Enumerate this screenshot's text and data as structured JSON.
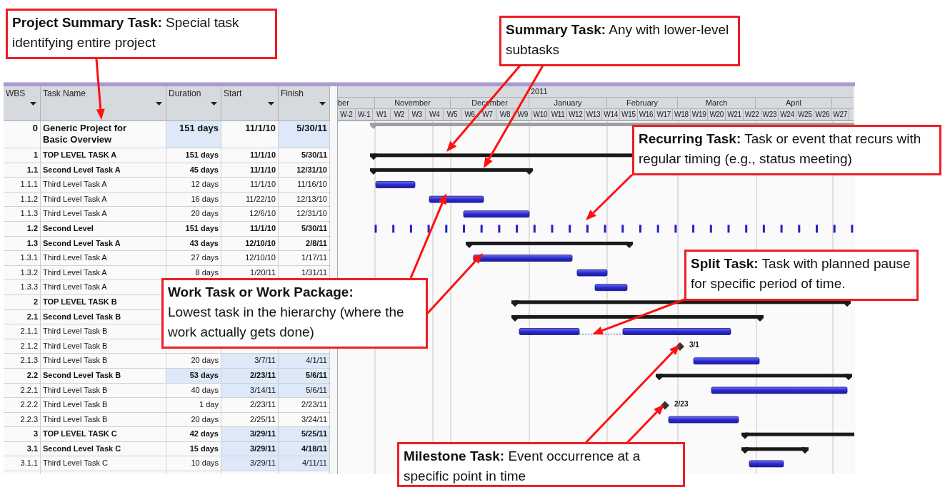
{
  "columns": [
    {
      "label": "WBS"
    },
    {
      "label": "Task Name"
    },
    {
      "label": "Duration"
    },
    {
      "label": "Start"
    },
    {
      "label": "Finish"
    }
  ],
  "timescale": {
    "year": "2011",
    "months": [
      "ber",
      "November",
      "December",
      "January",
      "February",
      "March",
      "April"
    ],
    "weeks": [
      "W-2",
      "W-1",
      "W1",
      "W2",
      "W3",
      "W4",
      "W5",
      "W6",
      "W7",
      "W8",
      "W9",
      "W10",
      "W11",
      "W12",
      "W13",
      "W14",
      "W15",
      "W16",
      "W17",
      "W18",
      "W19",
      "W20",
      "W21",
      "W22",
      "W23",
      "W24",
      "W25",
      "W26",
      "W27"
    ]
  },
  "rows": [
    {
      "wbs": "0",
      "name": "Generic Project for Basic Overview",
      "kind": "project",
      "cells": [
        {
          "text": "151 days",
          "highlighted": true
        },
        {
          "text": "11/1/10",
          "highlighted": false
        },
        {
          "text": "5/30/11",
          "highlighted": true
        }
      ]
    },
    {
      "wbs": "1",
      "name": "TOP LEVEL TASK A",
      "kind": "summary",
      "cells": [
        {
          "text": "151 days",
          "highlighted": false
        },
        {
          "text": "11/1/10",
          "highlighted": false
        },
        {
          "text": "5/30/11",
          "highlighted": false
        }
      ]
    },
    {
      "wbs": "1.1",
      "name": "Second Level Task A",
      "kind": "summary",
      "cells": [
        {
          "text": "45 days",
          "highlighted": false
        },
        {
          "text": "11/1/10",
          "highlighted": false
        },
        {
          "text": "12/31/10",
          "highlighted": false
        }
      ]
    },
    {
      "wbs": "1.1.1",
      "name": "Third Level Task A",
      "kind": "task",
      "cells": [
        {
          "text": "12 days",
          "highlighted": false
        },
        {
          "text": "11/1/10",
          "highlighted": false
        },
        {
          "text": "11/16/10",
          "highlighted": false
        }
      ]
    },
    {
      "wbs": "1.1.2",
      "name": "Third Level Task A",
      "kind": "task",
      "cells": [
        {
          "text": "16 days",
          "highlighted": false
        },
        {
          "text": "11/22/10",
          "highlighted": false
        },
        {
          "text": "12/13/10",
          "highlighted": false
        }
      ]
    },
    {
      "wbs": "1.1.3",
      "name": "Third Level Task A",
      "kind": "task",
      "cells": [
        {
          "text": "20 days",
          "highlighted": false
        },
        {
          "text": "12/6/10",
          "highlighted": false
        },
        {
          "text": "12/31/10",
          "highlighted": false
        }
      ]
    },
    {
      "wbs": "1.2",
      "name": "Second Level",
      "kind": "recurring",
      "cells": [
        {
          "text": "151 days",
          "highlighted": false
        },
        {
          "text": "11/1/10",
          "highlighted": false
        },
        {
          "text": "5/30/11",
          "highlighted": false
        }
      ]
    },
    {
      "wbs": "1.3",
      "name": "Second Level Task A",
      "kind": "summary",
      "cells": [
        {
          "text": "43 days",
          "highlighted": false
        },
        {
          "text": "12/10/10",
          "highlighted": false
        },
        {
          "text": "2/8/11",
          "highlighted": false
        }
      ]
    },
    {
      "wbs": "1.3.1",
      "name": "Third Level Task A",
      "kind": "task",
      "cells": [
        {
          "text": "27 days",
          "highlighted": false
        },
        {
          "text": "12/10/10",
          "highlighted": false
        },
        {
          "text": "1/17/11",
          "highlighted": false
        }
      ]
    },
    {
      "wbs": "1.3.2",
      "name": "Third Level Task A",
      "kind": "task",
      "cells": [
        {
          "text": "8 days",
          "highlighted": false
        },
        {
          "text": "1/20/11",
          "highlighted": false
        },
        {
          "text": "1/31/11",
          "highlighted": false
        }
      ]
    },
    {
      "wbs": "1.3.3",
      "name": "Third Level Task A",
      "kind": "task"
    },
    {
      "wbs": "2",
      "name": "TOP LEVEL TASK B",
      "kind": "summary"
    },
    {
      "wbs": "2.1",
      "name": "Second Level Task B",
      "kind": "summary"
    },
    {
      "wbs": "2.1.1",
      "name": "Third Level Task B",
      "kind": "split"
    },
    {
      "wbs": "2.1.2",
      "name": "Third Level Task B",
      "kind": "milestone",
      "milestone_label": "3/1"
    },
    {
      "wbs": "2.1.3",
      "name": "Third Level Task B",
      "kind": "task",
      "cells": [
        {
          "text": "20 days",
          "highlighted": false
        },
        {
          "text": "3/7/11",
          "highlighted": true
        },
        {
          "text": "4/1/11",
          "highlighted": true
        }
      ]
    },
    {
      "wbs": "2.2",
      "name": "Second Level Task B",
      "kind": "summary",
      "cells": [
        {
          "text": "53 days",
          "highlighted": true
        },
        {
          "text": "2/23/11",
          "highlighted": true
        },
        {
          "text": "5/6/11",
          "highlighted": true
        }
      ]
    },
    {
      "wbs": "2.2.1",
      "name": "Third Level Task B",
      "kind": "task",
      "cells": [
        {
          "text": "40 days",
          "highlighted": false
        },
        {
          "text": "3/14/11",
          "highlighted": true
        },
        {
          "text": "5/6/11",
          "highlighted": true
        }
      ]
    },
    {
      "wbs": "2.2.2",
      "name": "Third Level Task B",
      "kind": "milestone",
      "milestone_label": "2/23",
      "cells": [
        {
          "text": "1 day",
          "highlighted": false
        },
        {
          "text": "2/23/11",
          "highlighted": false
        },
        {
          "text": "2/23/11",
          "highlighted": false
        }
      ]
    },
    {
      "wbs": "2.2.3",
      "name": "Third Level Task B",
      "kind": "task",
      "cells": [
        {
          "text": "20 days",
          "highlighted": false
        },
        {
          "text": "2/25/11",
          "highlighted": false
        },
        {
          "text": "3/24/11",
          "highlighted": false
        }
      ]
    },
    {
      "wbs": "3",
      "name": "TOP LEVEL TASK C",
      "kind": "summary",
      "cells": [
        {
          "text": "42 days",
          "highlighted": false
        },
        {
          "text": "3/29/11",
          "highlighted": true
        },
        {
          "text": "5/25/11",
          "highlighted": true
        }
      ]
    },
    {
      "wbs": "3.1",
      "name": "Second Level Task C",
      "kind": "summary",
      "cells": [
        {
          "text": "15 days",
          "highlighted": false
        },
        {
          "text": "3/29/11",
          "highlighted": true
        },
        {
          "text": "4/18/11",
          "highlighted": true
        }
      ]
    },
    {
      "wbs": "3.1.1",
      "name": "Third Level Task C",
      "kind": "task",
      "cells": [
        {
          "text": "10 days",
          "highlighted": false
        },
        {
          "text": "3/29/11",
          "highlighted": true
        },
        {
          "text": "4/11/11",
          "highlighted": true
        }
      ]
    }
  ],
  "callouts": [
    {
      "kind": "inline",
      "text": "**Project Summary Task:** Special task identifying entire project"
    },
    {
      "kind": "inline",
      "text": "**Summary Task:** Any with lower-level subtasks"
    },
    {
      "kind": "inline",
      "text": "**Recurring Task:** Task or event that recurs with regular timing (e.g., status meeting)"
    },
    {
      "kind": "inline",
      "text": "**Split Task:** Task with planned pause for specific period of time."
    },
    {
      "kind": "stacked",
      "title": "Work Task or Work Package:",
      "text": "Lowest task in the hierarchy (where the work actually gets done)"
    },
    {
      "kind": "inline",
      "text": "**Milestone Task:** Event occurrence at a specific point in time"
    }
  ]
}
